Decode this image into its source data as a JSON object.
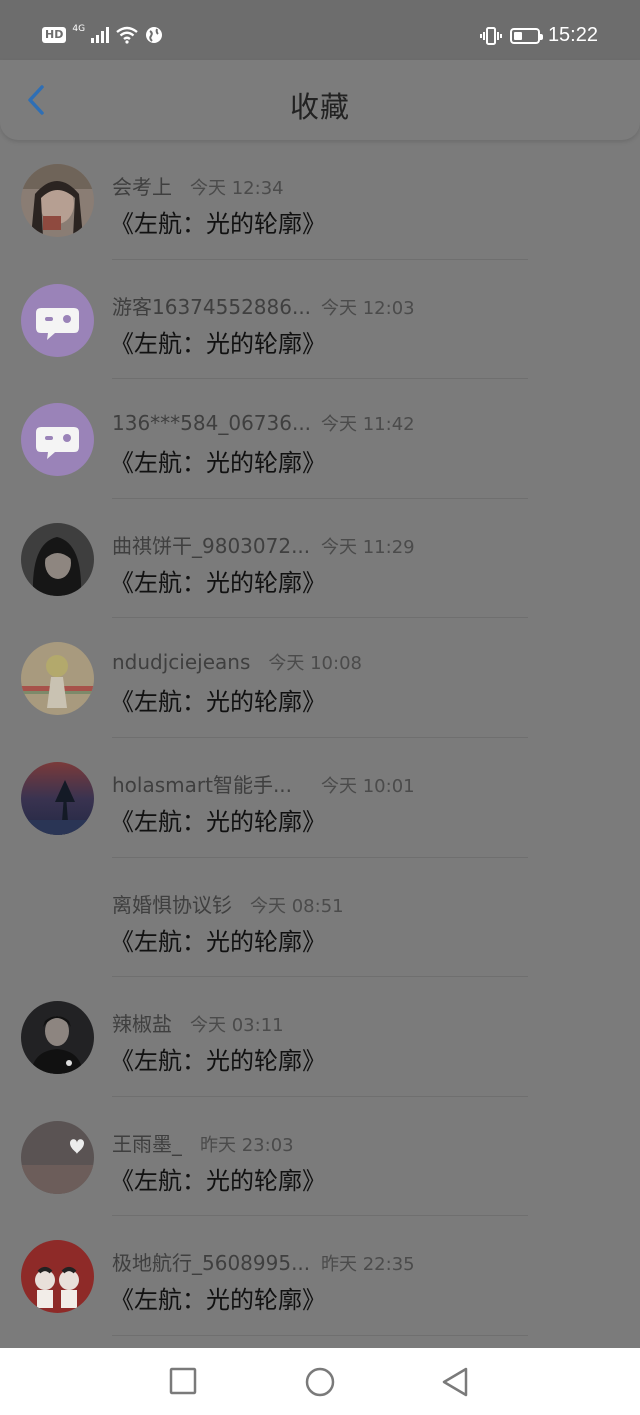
{
  "status_bar": {
    "time": "15:22",
    "hd_label": "HD",
    "network": "4G",
    "icons": [
      "hd-icon",
      "signal-icon",
      "wifi-icon",
      "globe-icon",
      "vibrate-icon",
      "battery-icon"
    ]
  },
  "header": {
    "title": "收藏",
    "back_icon": "chevron-left-icon"
  },
  "favorites": [
    {
      "user": "会考上",
      "time": "今天 12:34",
      "book": "《左航：光的轮廓》"
    },
    {
      "user": "游客16374552886...",
      "time": "今天 12:03",
      "book": "《左航：光的轮廓》"
    },
    {
      "user": "136***584_06736...",
      "time": "今天 11:42",
      "book": "《左航：光的轮廓》"
    },
    {
      "user": "曲祺饼干_9803072...",
      "time": "今天 11:29",
      "book": "《左航：光的轮廓》"
    },
    {
      "user": "ndudjciejeans",
      "time": "今天 10:08",
      "book": "《左航：光的轮廓》"
    },
    {
      "user": "holasmart智能手...",
      "time": "今天 10:01",
      "book": "《左航：光的轮廓》"
    },
    {
      "user": "离婚惧协议钐",
      "time": "今天 08:51",
      "book": "《左航：光的轮廓》"
    },
    {
      "user": "辣椒盐",
      "time": "今天 03:11",
      "book": "《左航：光的轮廓》"
    },
    {
      "user": "王雨墨_",
      "time": "昨天 23:03",
      "book": "《左航：光的轮廓》"
    },
    {
      "user": "极地航行_5608995...",
      "time": "昨天 22:35",
      "book": "《左航：光的轮廓》"
    }
  ],
  "system_nav": {
    "icons": [
      "recent-apps-icon",
      "home-icon",
      "back-icon"
    ]
  },
  "colors": {
    "accent": "#2f6fb5",
    "default_avatar": "#9a83b8"
  }
}
